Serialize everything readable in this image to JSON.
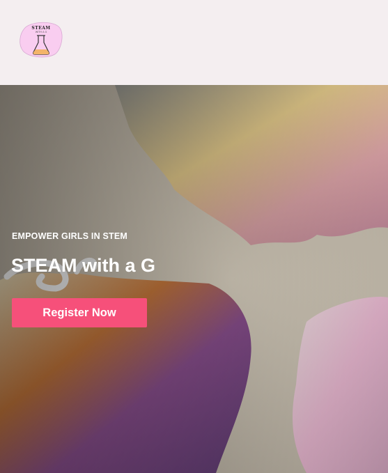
{
  "header": {
    "logo": {
      "icon": "flask-icon",
      "text": "STEAM",
      "subtext": "WITH A G"
    }
  },
  "hero": {
    "eyebrow": "EMPOWER GIRLS IN STEM",
    "title": "STEAM with a G",
    "cta_label": "Register Now",
    "colors": {
      "cta": "#f6507a",
      "header_bg": "#f4eef0"
    }
  }
}
